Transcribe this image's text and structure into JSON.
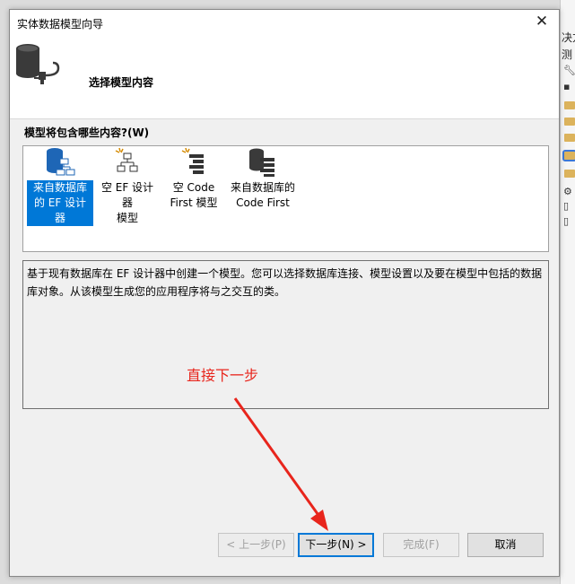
{
  "background": {
    "panel_text": [
      "决方",
      "测"
    ]
  },
  "dialog": {
    "title": "实体数据模型向导",
    "header_title": "选择模型内容",
    "section_label": "模型将包含哪些内容?(W)",
    "items": [
      {
        "label": "来自数据库\n的 EF 设计器",
        "icon": "database-model-icon",
        "selected": true
      },
      {
        "label": "空 EF 设计器\n模型",
        "icon": "empty-model-icon",
        "selected": false
      },
      {
        "label": "空 Code\nFirst 模型",
        "icon": "empty-code-first-icon",
        "selected": false
      },
      {
        "label": "来自数据库的\nCode First",
        "icon": "database-code-first-icon",
        "selected": false
      }
    ],
    "description": "基于现有数据库在 EF 设计器中创建一个模型。您可以选择数据库连接、模型设置以及要在模型中包括的数据库对象。从该模型生成您的应用程序将与之交互的类。",
    "buttons": {
      "prev": "< 上一步(P)",
      "next": "下一步(N) >",
      "finish": "完成(F)",
      "cancel": "取消"
    }
  },
  "annotation": {
    "text": "直接下一步",
    "color": "#e8251c"
  },
  "colors": {
    "selection": "#0078d7"
  }
}
